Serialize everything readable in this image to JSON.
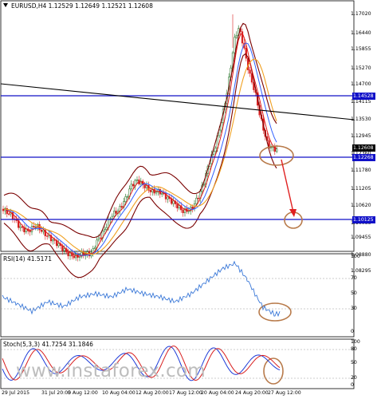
{
  "main_header": "EURUSD,H4  1.12529 1.12649 1.12521 1.12608",
  "rsi_header": "RSI(14) 41.5171",
  "stoch_header": "Stoch(5,3,3) 41.7254 31.1846",
  "price_ticks": [
    "1.17020",
    "1.16440",
    "1.15855",
    "1.15270",
    "1.14700",
    "1.14115",
    "1.13530",
    "1.12945",
    "1.12360",
    "1.11780",
    "1.11205",
    "1.10620",
    "1.10035",
    "1.09455",
    "1.08880",
    "1.08295"
  ],
  "price_tags": {
    "level_high": "1.14528",
    "current": "1.12608",
    "level_mid": "1.12268",
    "level_low": "1.10125"
  },
  "rsi_ticks": [
    "100",
    "70",
    "50",
    "30",
    "0"
  ],
  "stoch_ticks": [
    "100",
    "80",
    "50",
    "20",
    "0"
  ],
  "x_ticks": [
    "29 Jul 2015",
    "31 Jul 20:00",
    "5 Aug 12:00",
    "10 Aug 04:00",
    "12 Aug 20:00",
    "17 Aug 12:00",
    "20 Aug 04:00",
    "24 Aug 20:00",
    "27 Aug 12:00"
  ],
  "watermark": "www.instaforex.com",
  "colors": {
    "support_line": "#1010c8",
    "trend_line": "#000000",
    "candle_up": "#1c6b1c",
    "candle_down": "#d81e1e",
    "bollinger": "#7a0000",
    "ma_fast": "#e01818",
    "ma_mid": "#3060ff",
    "ma_slow": "#f0a020",
    "rsi_line": "#3a78d8",
    "stoch_main": "#1c3ad8",
    "stoch_signal": "#d81e1e",
    "annotation": "#b87a4a"
  }
}
